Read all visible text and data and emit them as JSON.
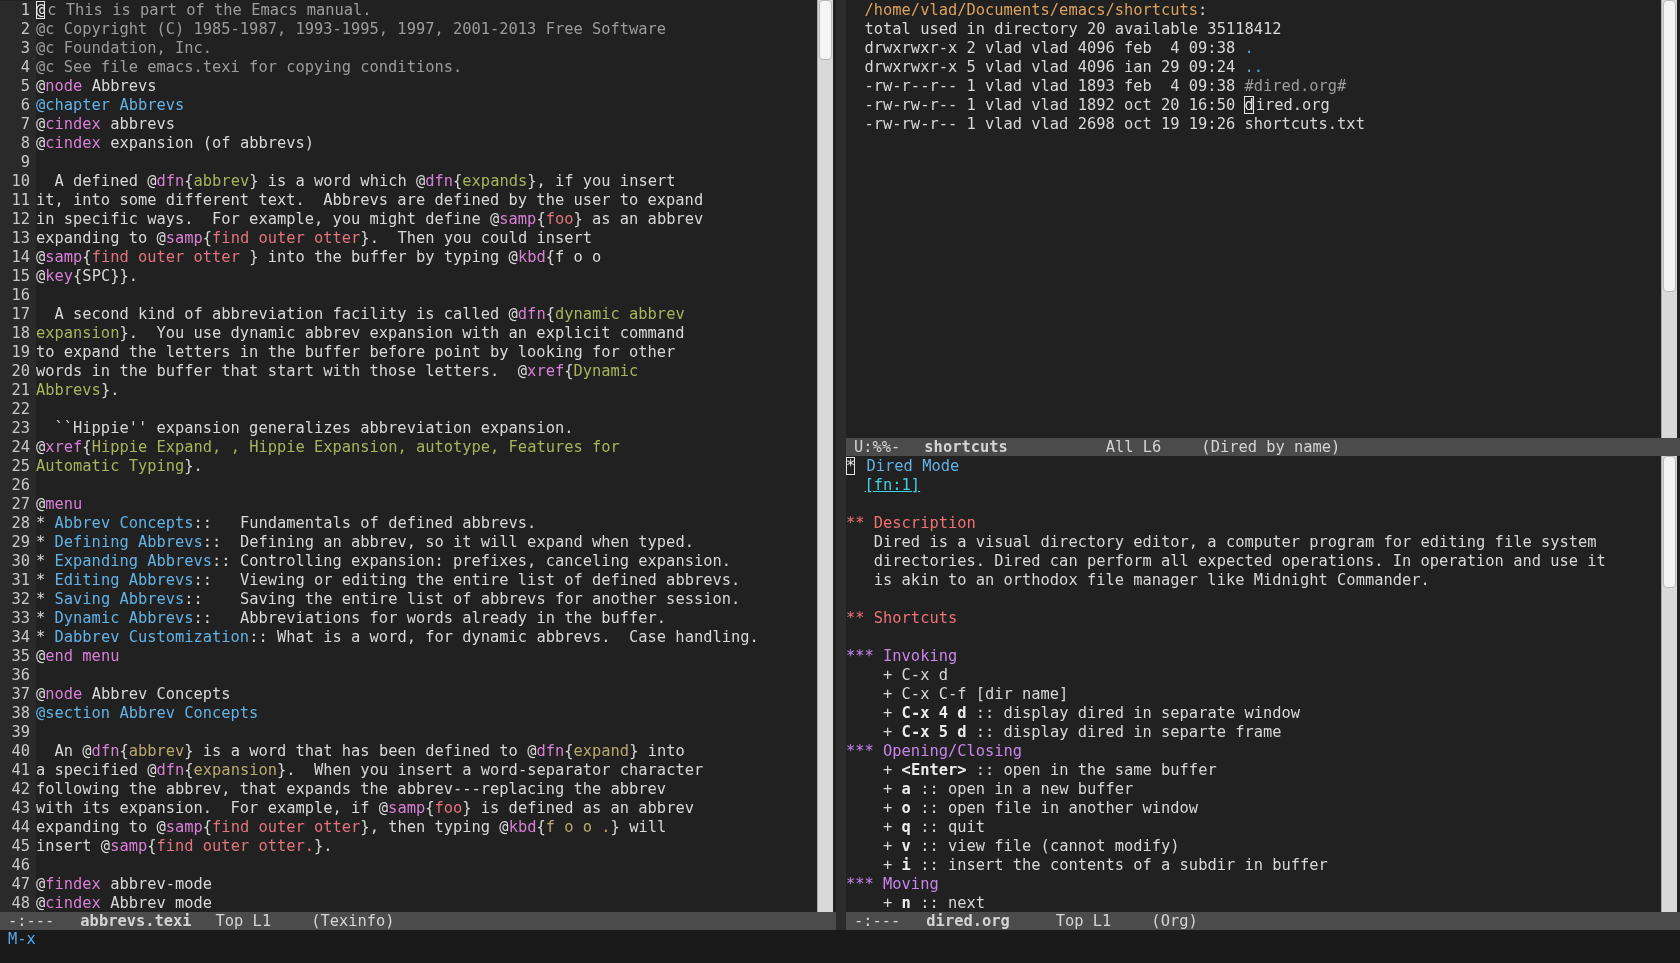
{
  "left_window": {
    "lines": [
      {
        "number": "1",
        "segments": [
          {
            "kind": "cursor",
            "text": "@"
          },
          {
            "kind": "comment",
            "text": "c This is part of the Emacs manual."
          }
        ]
      },
      {
        "number": "2",
        "segments": [
          {
            "kind": "comment",
            "text": "@c Copyright (C) 1985-1987, 1993-1995, 1997, 2001-2013 Free Software"
          }
        ]
      },
      {
        "number": "3",
        "segments": [
          {
            "kind": "comment",
            "text": "@c Foundation, Inc."
          }
        ]
      },
      {
        "number": "4",
        "segments": [
          {
            "kind": "comment",
            "text": "@c See file emacs.texi for copying conditions."
          }
        ]
      },
      {
        "number": "5",
        "segments": [
          "@",
          {
            "kind": "keyword",
            "text": "node"
          },
          " Abbrevs"
        ]
      },
      {
        "number": "6",
        "segments": [
          {
            "kind": "heading",
            "text": "@chapter Abbrevs"
          }
        ]
      },
      {
        "number": "7",
        "segments": [
          "@",
          {
            "kind": "keyword",
            "text": "cindex"
          },
          " abbrevs"
        ]
      },
      {
        "number": "8",
        "segments": [
          "@",
          {
            "kind": "keyword",
            "text": "cindex"
          },
          " expansion (of abbrevs)"
        ]
      },
      {
        "number": "9"
      },
      {
        "number": "10",
        "segments": [
          "  A defined @",
          {
            "kind": "keyword",
            "text": "dfn"
          },
          "{",
          {
            "kind": "green",
            "text": "abbrev"
          },
          "} is a word which @",
          {
            "kind": "keyword",
            "text": "dfn"
          },
          "{",
          {
            "kind": "green",
            "text": "expands"
          },
          "}, if you insert"
        ]
      },
      {
        "number": "11",
        "segments": [
          "it, into some different text.  Abbrevs are defined by the user to expand"
        ]
      },
      {
        "number": "12",
        "segments": [
          "in specific ways.  For example, you might define @",
          {
            "kind": "keyword",
            "text": "samp"
          },
          "{",
          {
            "kind": "string",
            "text": "foo"
          },
          "} as an abbrev"
        ]
      },
      {
        "number": "13",
        "segments": [
          "expanding to @",
          {
            "kind": "keyword",
            "text": "samp"
          },
          "{",
          {
            "kind": "string",
            "text": "find outer otter"
          },
          "}.  Then you could insert"
        ]
      },
      {
        "number": "14",
        "segments": [
          "@",
          {
            "kind": "keyword",
            "text": "samp"
          },
          "{",
          {
            "kind": "string",
            "text": "find outer otter "
          },
          "} into the buffer by typing @",
          {
            "kind": "keyword",
            "text": "kbd"
          },
          "{f o o"
        ]
      },
      {
        "number": "15",
        "segments": [
          "@",
          {
            "kind": "keyword",
            "text": "key"
          },
          "{SPC}}."
        ]
      },
      {
        "number": "16"
      },
      {
        "number": "17",
        "segments": [
          "  A second kind of abbreviation facility is called @",
          {
            "kind": "keyword",
            "text": "dfn"
          },
          "{",
          {
            "kind": "green",
            "text": "dynamic abbrev"
          }
        ]
      },
      {
        "number": "18",
        "segments": [
          {
            "kind": "green",
            "text": "expansion"
          },
          "}.  You use dynamic abbrev expansion with an explicit command"
        ]
      },
      {
        "number": "19",
        "segments": [
          "to expand the letters in the buffer before point by looking for other"
        ]
      },
      {
        "number": "20",
        "segments": [
          "words in the buffer that start with those letters.  @",
          {
            "kind": "keyword",
            "text": "xref"
          },
          "{",
          {
            "kind": "green",
            "text": "Dynamic"
          }
        ]
      },
      {
        "number": "21",
        "segments": [
          {
            "kind": "green",
            "text": "Abbrevs"
          },
          "}."
        ]
      },
      {
        "number": "22"
      },
      {
        "number": "23",
        "segments": [
          "  ``Hippie'' expansion generalizes abbreviation expansion."
        ]
      },
      {
        "number": "24",
        "segments": [
          "@",
          {
            "kind": "keyword",
            "text": "xref"
          },
          "{",
          {
            "kind": "green",
            "text": "Hippie Expand, , Hippie Expansion, autotype, Features for"
          }
        ]
      },
      {
        "number": "25",
        "segments": [
          {
            "kind": "green",
            "text": "Automatic Typing"
          },
          "}."
        ]
      },
      {
        "number": "26"
      },
      {
        "number": "27",
        "segments": [
          "@",
          {
            "kind": "keyword",
            "text": "menu"
          }
        ]
      },
      {
        "number": "28",
        "segments": [
          "* ",
          {
            "kind": "heading",
            "text": "Abbrev Concepts"
          },
          "::   Fundamentals of defined abbrevs."
        ]
      },
      {
        "number": "29",
        "segments": [
          "* ",
          {
            "kind": "heading",
            "text": "Defining Abbrevs"
          },
          "::  Defining an abbrev, so it will expand when typed."
        ]
      },
      {
        "number": "30",
        "segments": [
          "* ",
          {
            "kind": "heading",
            "text": "Expanding Abbrevs"
          },
          ":: Controlling expansion: prefixes, canceling expansion."
        ]
      },
      {
        "number": "31",
        "segments": [
          "* ",
          {
            "kind": "heading",
            "text": "Editing Abbrevs"
          },
          "::   Viewing or editing the entire list of defined abbrevs."
        ]
      },
      {
        "number": "32",
        "segments": [
          "* ",
          {
            "kind": "heading",
            "text": "Saving Abbrevs"
          },
          "::    Saving the entire list of abbrevs for another session."
        ]
      },
      {
        "number": "33",
        "segments": [
          "* ",
          {
            "kind": "heading",
            "text": "Dynamic Abbrevs"
          },
          "::   Abbreviations for words already in the buffer."
        ]
      },
      {
        "number": "34",
        "segments": [
          "* ",
          {
            "kind": "heading",
            "text": "Dabbrev Customization"
          },
          ":: What is a word, for dynamic abbrevs.  Case handling."
        ]
      },
      {
        "number": "35",
        "segments": [
          "@",
          {
            "kind": "keyword",
            "text": "end menu"
          }
        ]
      },
      {
        "number": "36"
      },
      {
        "number": "37",
        "segments": [
          "@",
          {
            "kind": "keyword",
            "text": "node"
          },
          " Abbrev Concepts"
        ]
      },
      {
        "number": "38",
        "segments": [
          {
            "kind": "heading",
            "text": "@section Abbrev Concepts"
          }
        ]
      },
      {
        "number": "39"
      },
      {
        "number": "40",
        "segments": [
          "  An @",
          {
            "kind": "keyword",
            "text": "dfn"
          },
          "{",
          {
            "kind": "khaki",
            "text": "abbrev"
          },
          "} is a word that has been defined to @",
          {
            "kind": "keyword",
            "text": "dfn"
          },
          "{",
          {
            "kind": "khaki",
            "text": "expand"
          },
          "} into"
        ]
      },
      {
        "number": "41",
        "segments": [
          "a specified @",
          {
            "kind": "keyword",
            "text": "dfn"
          },
          "{",
          {
            "kind": "khaki",
            "text": "expansion"
          },
          "}.  When you insert a word-separator character"
        ]
      },
      {
        "number": "42",
        "segments": [
          "following the abbrev, that expands the abbrev---replacing the abbrev"
        ]
      },
      {
        "number": "43",
        "segments": [
          "with its expansion.  For example, if @",
          {
            "kind": "keyword",
            "text": "samp"
          },
          "{",
          {
            "kind": "string",
            "text": "foo"
          },
          "} is defined as an abbrev"
        ]
      },
      {
        "number": "44",
        "segments": [
          "expanding to @",
          {
            "kind": "keyword",
            "text": "samp"
          },
          "{",
          {
            "kind": "string",
            "text": "find outer otter"
          },
          "}, then typing @",
          {
            "kind": "keyword",
            "text": "kbd"
          },
          "{",
          {
            "kind": "khaki",
            "text": "f o o ."
          },
          "} will"
        ]
      },
      {
        "number": "45",
        "segments": [
          "insert @",
          {
            "kind": "keyword",
            "text": "samp"
          },
          "{",
          {
            "kind": "string",
            "text": "find outer otter."
          },
          "}."
        ]
      },
      {
        "number": "46"
      },
      {
        "number": "47",
        "segments": [
          "@",
          {
            "kind": "keyword",
            "text": "findex"
          },
          " abbrev-mode"
        ]
      },
      {
        "number": "48",
        "segments": [
          "@",
          {
            "kind": "keyword",
            "text": "cindex"
          },
          " Abbrev mode"
        ]
      }
    ],
    "mode_line": {
      "flags": "-:---",
      "buffer": "abbrevs.texi",
      "position": "Top L1",
      "mode": "(Texinfo)"
    }
  },
  "right_top_window": {
    "lines": [
      {
        "segments": [
          {
            "kind": "path",
            "text": "/home/vlad/Documents/emacs/shortcuts"
          },
          ":"
        ]
      },
      {
        "segments": [
          "total used in directory 20 available 35118412"
        ]
      },
      {
        "segments": [
          "drwxrwxr-x 2 vlad vlad 4096 feb  4 09:38 ",
          {
            "kind": "dir",
            "text": "."
          }
        ]
      },
      {
        "segments": [
          "drwxrwxr-x 5 vlad vlad 4096 ian 29 09:24 ",
          {
            "kind": "dir",
            "text": ".."
          }
        ]
      },
      {
        "segments": [
          "-rw-r--r-- 1 vlad vlad 1893 feb  4 09:38 ",
          {
            "kind": "comment",
            "text": "#dired.org#"
          }
        ]
      },
      {
        "segments": [
          "-rw-rw-r-- 1 vlad vlad 1892 oct 20 16:50 ",
          {
            "kind": "cursor",
            "text": "d"
          },
          "ired.org"
        ]
      },
      {
        "segments": [
          "-rw-rw-r-- 1 vlad vlad 2698 oct 19 19:26 shortcuts.txt"
        ]
      }
    ],
    "mode_line": {
      "flags": "U:%%-",
      "buffer": "shortcuts",
      "position": "All L6",
      "mode": "(Dired by name)"
    }
  },
  "right_bottom_window": {
    "lines": [
      {
        "segments": [
          {
            "kind": "cursor",
            "text": "*"
          },
          {
            "kind": "heading",
            "text": "Dired Mode"
          }
        ]
      },
      {
        "segments": [
          {
            "kind": "link",
            "text": "[fn:1]"
          }
        ]
      },
      {
        "space_before": true,
        "segments": [
          {
            "kind": "level2",
            "text": "** Description"
          }
        ]
      },
      {
        "segments": [
          "   Dired is a visual directory editor, a computer program for editing file system"
        ]
      },
      {
        "segments": [
          "   directories. Dired can perform all expected operations. In operation and use it"
        ]
      },
      {
        "segments": [
          "   is akin to an orthodox file manager like Midnight Commander."
        ]
      },
      {
        "space_before": true,
        "segments": [
          {
            "kind": "level2",
            "text": "** Shortcuts"
          }
        ]
      },
      {
        "space_before": true,
        "segments": [
          {
            "kind": "level3",
            "text": "*** Invoking"
          }
        ]
      },
      {
        "segments": [
          "    + C-x d"
        ]
      },
      {
        "segments": [
          "    + C-x C-f [dir name]"
        ]
      },
      {
        "segments": [
          "    + ",
          {
            "kind": "bold",
            "text": "C-x 4 d"
          },
          " :: display dired in separate window"
        ]
      },
      {
        "segments": [
          "    + ",
          {
            "kind": "bold",
            "text": "C-x 5 d"
          },
          " :: display dired in separte frame"
        ]
      },
      {
        "segments": [
          {
            "kind": "level3",
            "text": "*** Opening/Closing"
          }
        ]
      },
      {
        "segments": [
          "    + ",
          {
            "kind": "bold",
            "text": "<Enter>"
          },
          " :: open in the same buffer"
        ]
      },
      {
        "segments": [
          "    + ",
          {
            "kind": "bold",
            "text": "a"
          },
          " :: open in a new buffer"
        ]
      },
      {
        "segments": [
          "    + ",
          {
            "kind": "bold",
            "text": "o"
          },
          " :: open file in another window"
        ]
      },
      {
        "segments": [
          "    + ",
          {
            "kind": "bold",
            "text": "q"
          },
          " :: quit"
        ]
      },
      {
        "segments": [
          "    + ",
          {
            "kind": "bold",
            "text": "v"
          },
          " :: view file (cannot modify)"
        ]
      },
      {
        "segments": [
          "    + ",
          {
            "kind": "bold",
            "text": "i"
          },
          " :: insert the contents of a subdir in buffer"
        ]
      },
      {
        "segments": [
          {
            "kind": "level3",
            "text": "*** Moving"
          }
        ]
      },
      {
        "segments": [
          "    + ",
          {
            "kind": "bold",
            "text": "n"
          },
          " :: next"
        ]
      }
    ],
    "mode_line": {
      "flags": "-:---",
      "buffer": "dired.org",
      "position": "Top L1",
      "mode": "(Org)"
    }
  },
  "minibuffer": {
    "prompt": "M-x"
  }
}
